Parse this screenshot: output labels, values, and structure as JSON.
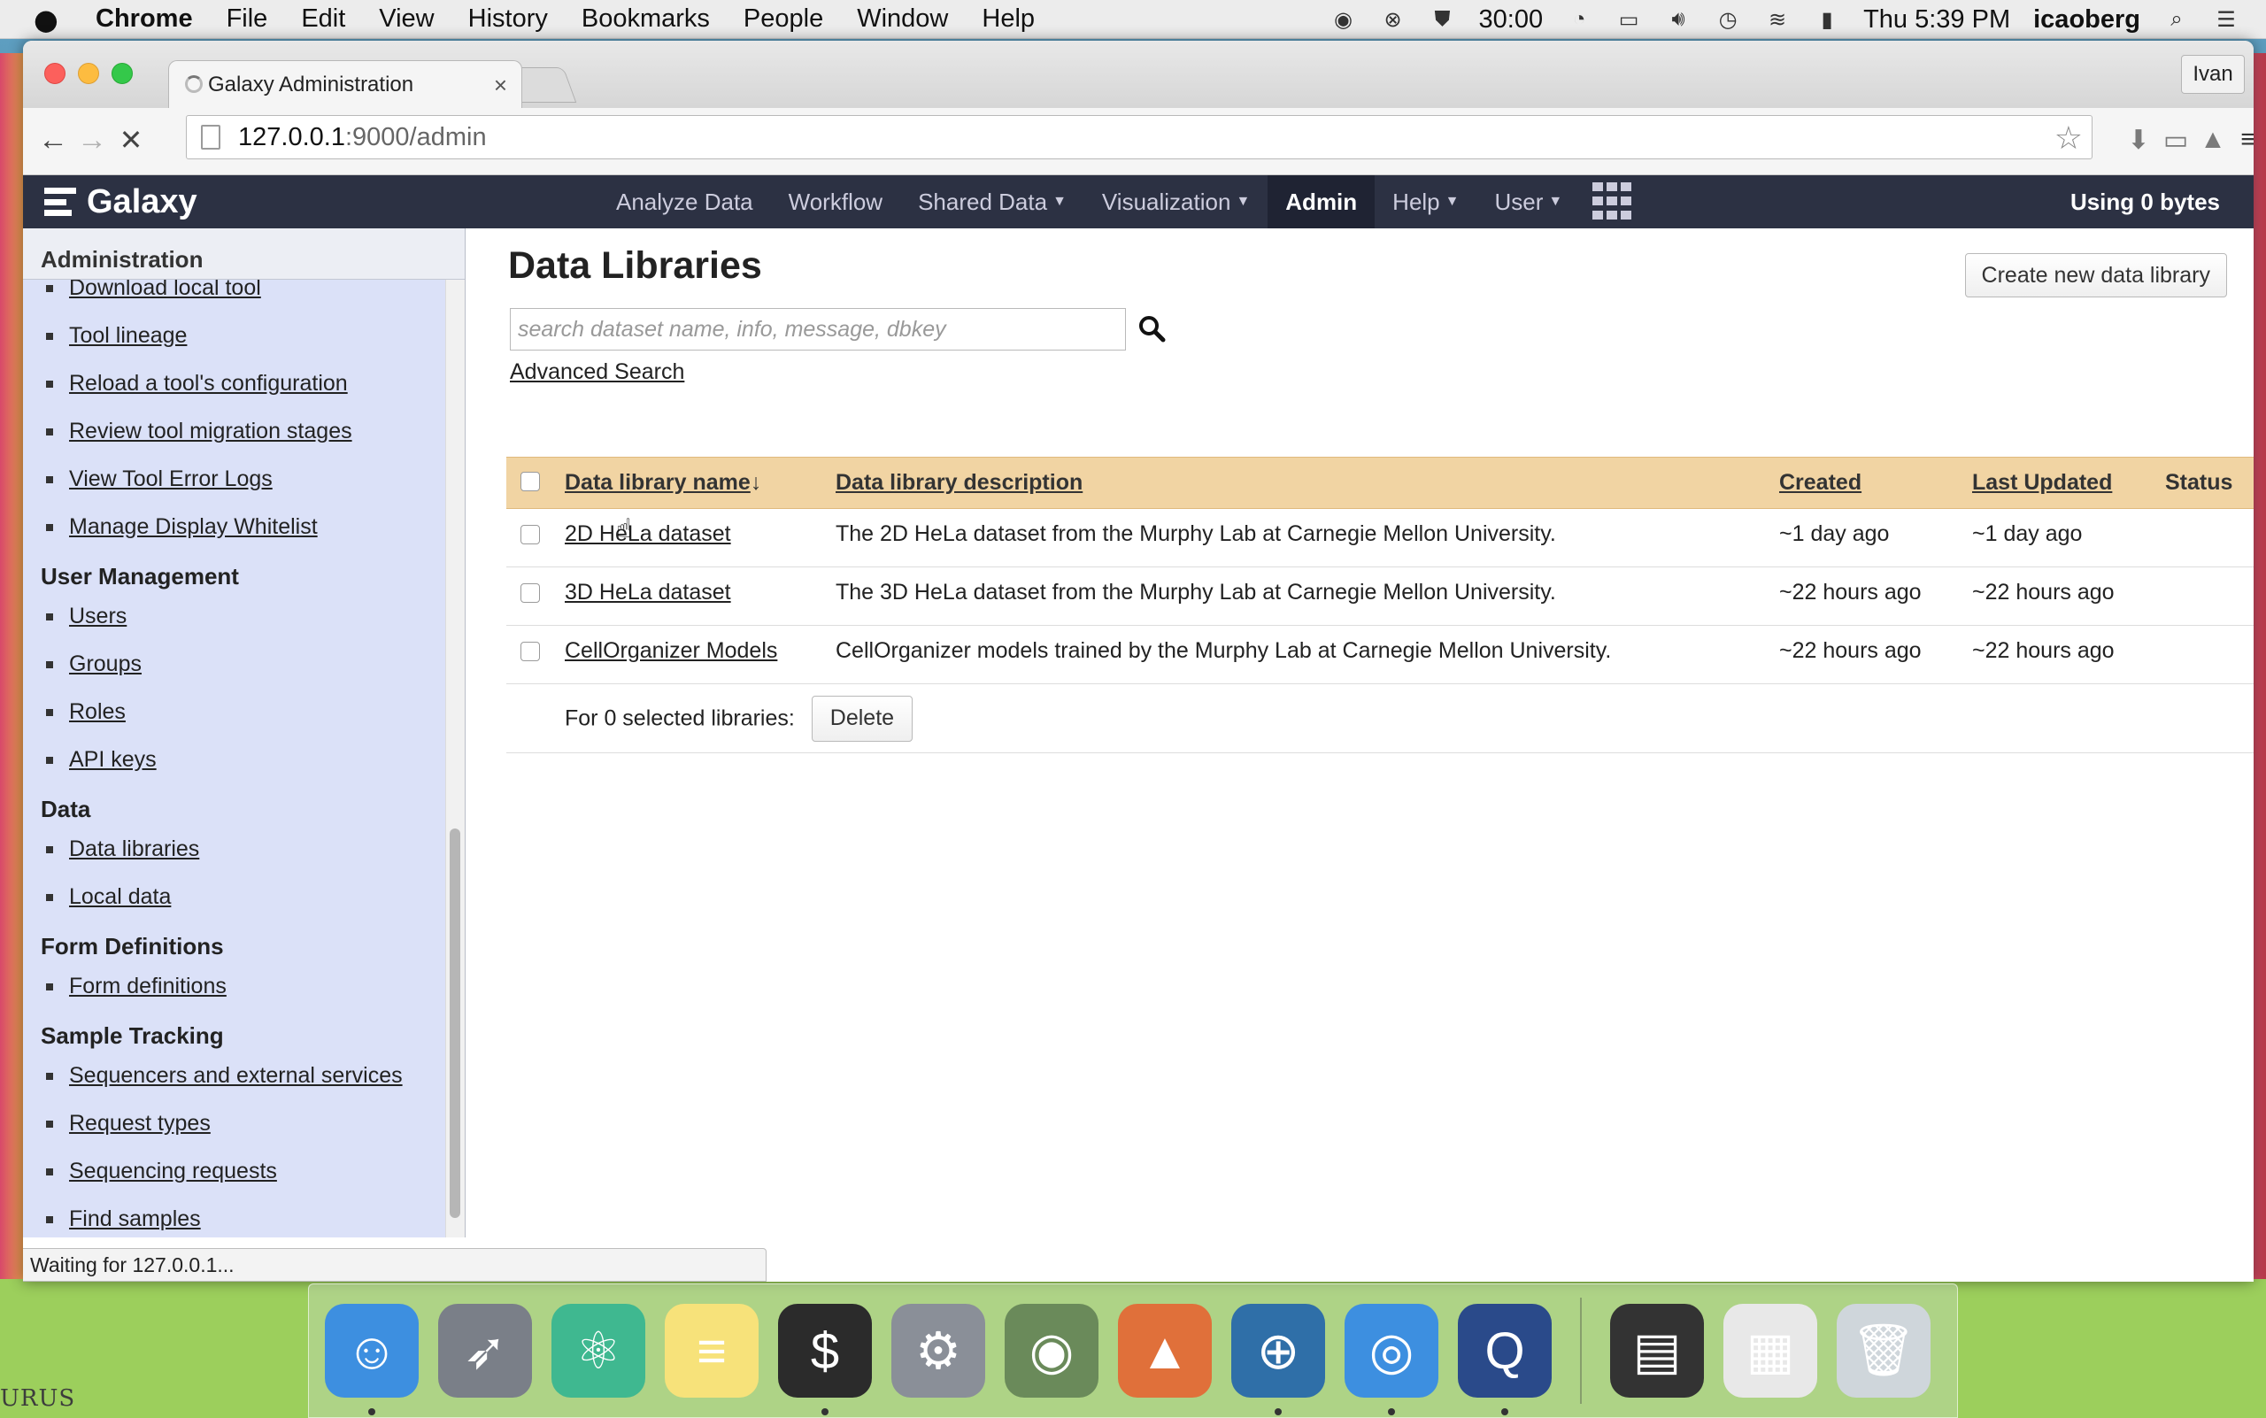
{
  "menubar": {
    "app": "Chrome",
    "items": [
      "File",
      "Edit",
      "View",
      "History",
      "Bookmarks",
      "People",
      "Window",
      "Help"
    ],
    "timer": "30:00",
    "clock": "Thu 5:39 PM",
    "user": "icaoberg"
  },
  "browser": {
    "tab_title": "Galaxy Administration",
    "profile": "Ivan",
    "url_host": "127.0.0.1",
    "url_path": ":9000/admin",
    "status_text": "Waiting for 127.0.0.1..."
  },
  "masthead": {
    "brand": "Galaxy",
    "nav": [
      {
        "label": "Analyze Data",
        "dropdown": false,
        "active": false
      },
      {
        "label": "Workflow",
        "dropdown": false,
        "active": false
      },
      {
        "label": "Shared Data",
        "dropdown": true,
        "active": false
      },
      {
        "label": "Visualization",
        "dropdown": true,
        "active": false
      },
      {
        "label": "Admin",
        "dropdown": false,
        "active": true
      },
      {
        "label": "Help",
        "dropdown": true,
        "active": false
      },
      {
        "label": "User",
        "dropdown": true,
        "active": false
      }
    ],
    "quota": "Using 0 bytes"
  },
  "leftpanel": {
    "header": "Administration",
    "top_items": [
      "Download local tool",
      "Tool lineage",
      "Reload a tool's configuration",
      "Review tool migration stages",
      "View Tool Error Logs",
      "Manage Display Whitelist"
    ],
    "sections": [
      {
        "title": "User Management",
        "items": [
          "Users",
          "Groups",
          "Roles",
          "API keys"
        ]
      },
      {
        "title": "Data",
        "items": [
          "Data libraries",
          "Local data"
        ]
      },
      {
        "title": "Form Definitions",
        "items": [
          "Form definitions"
        ]
      },
      {
        "title": "Sample Tracking",
        "items": [
          "Sequencers and external services",
          "Request types",
          "Sequencing requests",
          "Find samples"
        ]
      }
    ]
  },
  "main": {
    "title": "Data Libraries",
    "create_button": "Create new data library",
    "search_placeholder": "search dataset name, info, message, dbkey",
    "advanced_search": "Advanced Search",
    "columns": {
      "name": "Data library name",
      "sort_arrow": "↓",
      "description": "Data library description",
      "created": "Created",
      "updated": "Last Updated",
      "status": "Status"
    },
    "rows": [
      {
        "name": "2D HeLa dataset",
        "description": "The 2D HeLa dataset from the Murphy Lab at Carnegie Mellon University.",
        "created": "~1 day ago",
        "updated": "~1 day ago"
      },
      {
        "name": "3D HeLa dataset",
        "description": "The 3D HeLa dataset from the Murphy Lab at Carnegie Mellon University.",
        "created": "~22 hours ago",
        "updated": "~22 hours ago"
      },
      {
        "name": "CellOrganizer Models",
        "description": "CellOrganizer models trained by the Murphy Lab at Carnegie Mellon University.",
        "created": "~22 hours ago",
        "updated": "~22 hours ago"
      }
    ],
    "selected_label": "For 0 selected libraries:",
    "delete_button": "Delete"
  },
  "desktop": {
    "wallpaper_text": "URUS"
  },
  "dock": {
    "items": [
      {
        "name": "finder-icon",
        "color": "#3d8fe0",
        "glyph": "☺",
        "running": true
      },
      {
        "name": "launchpad-icon",
        "color": "#7a7f88",
        "glyph": "➶",
        "running": false
      },
      {
        "name": "atom-icon",
        "color": "#3fb890",
        "glyph": "⚛",
        "running": false
      },
      {
        "name": "notes-icon",
        "color": "#f7e27a",
        "glyph": "≡",
        "running": false
      },
      {
        "name": "terminal-icon",
        "color": "#2b2b2b",
        "glyph": "$",
        "running": true
      },
      {
        "name": "system-preferences-icon",
        "color": "#8a8f98",
        "glyph": "⚙",
        "running": false
      },
      {
        "name": "preview-icon",
        "color": "#6a8a5a",
        "glyph": "◉",
        "running": false
      },
      {
        "name": "matlab-icon",
        "color": "#e0703a",
        "glyph": "▲",
        "running": false
      },
      {
        "name": "vpn-icon",
        "color": "#2f6fa8",
        "glyph": "⊕",
        "running": true
      },
      {
        "name": "chrome-icon",
        "color": "#3d8fe0",
        "glyph": "◎",
        "running": true
      },
      {
        "name": "quicktime-icon",
        "color": "#2a4a8a",
        "glyph": "Q",
        "running": true
      },
      {
        "name": "terminal-window-icon",
        "color": "#333",
        "glyph": "▤",
        "running": false
      },
      {
        "name": "chrome-window-icon",
        "color": "#e8e8e8",
        "glyph": "▦",
        "running": false
      },
      {
        "name": "trash-icon",
        "color": "#cfd6db",
        "glyph": "🗑",
        "running": false
      }
    ]
  },
  "colors": {
    "masthead": "#2c3143",
    "table_header": "#f1d4a3",
    "leftpanel": "#dbe1f8"
  }
}
